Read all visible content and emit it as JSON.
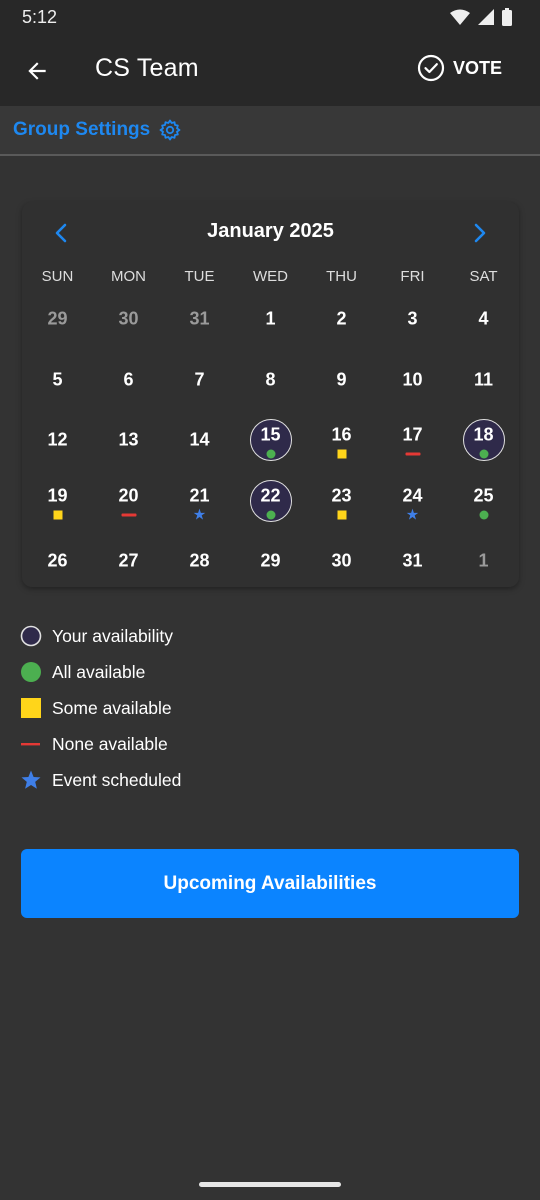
{
  "status": {
    "time": "5:12"
  },
  "appbar": {
    "title": "CS Team",
    "vote_label": "VOTE"
  },
  "group": {
    "label": "Group Settings"
  },
  "calendar": {
    "month": "January 2025",
    "weekdays": [
      "SUN",
      "MON",
      "TUE",
      "WED",
      "THU",
      "FRI",
      "SAT"
    ],
    "weeks": [
      [
        {
          "d": "29",
          "muted": true
        },
        {
          "d": "30",
          "muted": true
        },
        {
          "d": "31",
          "muted": true
        },
        {
          "d": "1"
        },
        {
          "d": "2"
        },
        {
          "d": "3"
        },
        {
          "d": "4"
        }
      ],
      [
        {
          "d": "5"
        },
        {
          "d": "6"
        },
        {
          "d": "7"
        },
        {
          "d": "8"
        },
        {
          "d": "9"
        },
        {
          "d": "10"
        },
        {
          "d": "11"
        }
      ],
      [
        {
          "d": "12"
        },
        {
          "d": "13"
        },
        {
          "d": "14"
        },
        {
          "d": "15",
          "ring": true,
          "marker": "all"
        },
        {
          "d": "16",
          "marker": "some"
        },
        {
          "d": "17",
          "marker": "none"
        },
        {
          "d": "18",
          "ring": true,
          "marker": "all"
        }
      ],
      [
        {
          "d": "19",
          "marker": "some"
        },
        {
          "d": "20",
          "marker": "none"
        },
        {
          "d": "21",
          "marker": "event"
        },
        {
          "d": "22",
          "ring": true,
          "marker": "all"
        },
        {
          "d": "23",
          "marker": "some"
        },
        {
          "d": "24",
          "marker": "event"
        },
        {
          "d": "25",
          "marker": "all"
        }
      ],
      [
        {
          "d": "26"
        },
        {
          "d": "27"
        },
        {
          "d": "28"
        },
        {
          "d": "29"
        },
        {
          "d": "30"
        },
        {
          "d": "31"
        },
        {
          "d": "1",
          "muted": true
        }
      ]
    ]
  },
  "legend": [
    {
      "symbol": "your",
      "label": "Your availability"
    },
    {
      "symbol": "all",
      "label": "All available"
    },
    {
      "symbol": "some",
      "label": "Some available"
    },
    {
      "symbol": "none",
      "label": "None available"
    },
    {
      "symbol": "event",
      "label": "Event scheduled"
    }
  ],
  "button": {
    "label": "Upcoming Availabilities"
  },
  "colors": {
    "accent": "#0b84ff",
    "link": "#1e88f0",
    "all": "#4caf50",
    "some": "#ffd51a",
    "none": "#e53935",
    "event": "#3f7fe8"
  }
}
